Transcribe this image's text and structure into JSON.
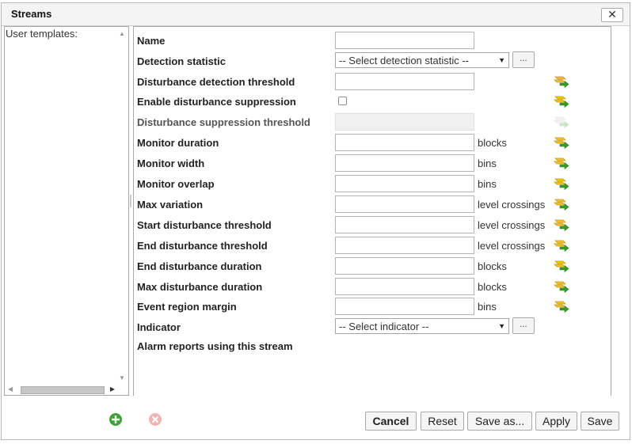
{
  "dialog": {
    "title": "Streams",
    "close_label": "✕"
  },
  "left_panel": {
    "label": "User templates:"
  },
  "form": {
    "rows": [
      {
        "label": "Name",
        "control": "input",
        "unit": "",
        "edit_icon": "none"
      },
      {
        "label": "Detection statistic",
        "control": "select",
        "value": "-- Select detection statistic --",
        "button": "...",
        "unit": "",
        "edit_icon": "none"
      },
      {
        "label": "Disturbance detection threshold",
        "control": "input",
        "unit": "",
        "edit_icon": "edit-icon"
      },
      {
        "label": "Enable disturbance suppression",
        "control": "checkbox",
        "checked": false,
        "unit": "",
        "edit_icon": "edit-icon"
      },
      {
        "label": "Disturbance suppression threshold",
        "control": "input-disabled",
        "unit": "",
        "edit_icon": "edit-icon-disabled"
      },
      {
        "label": "Monitor duration",
        "control": "input",
        "unit": "blocks",
        "edit_icon": "edit-icon"
      },
      {
        "label": "Monitor width",
        "control": "input",
        "unit": "bins",
        "edit_icon": "edit-icon"
      },
      {
        "label": "Monitor overlap",
        "control": "input",
        "unit": "bins",
        "edit_icon": "edit-icon"
      },
      {
        "label": "Max variation",
        "control": "input",
        "unit": "level crossings",
        "edit_icon": "edit-icon"
      },
      {
        "label": "Start disturbance threshold",
        "control": "input",
        "unit": "level crossings",
        "edit_icon": "edit-icon"
      },
      {
        "label": "End disturbance threshold",
        "control": "input",
        "unit": "level crossings",
        "edit_icon": "edit-icon"
      },
      {
        "label": "End disturbance duration",
        "control": "input",
        "unit": "blocks",
        "edit_icon": "edit-icon"
      },
      {
        "label": "Max disturbance duration",
        "control": "input",
        "unit": "blocks",
        "edit_icon": "edit-icon"
      },
      {
        "label": "Event region margin",
        "control": "input",
        "unit": "bins",
        "edit_icon": "edit-icon"
      },
      {
        "label": "Indicator",
        "control": "select",
        "value": "-- Select indicator --",
        "button": "...",
        "unit": "",
        "edit_icon": "none"
      },
      {
        "label": "Alarm reports using this stream",
        "control": "none",
        "unit": "",
        "edit_icon": "none"
      }
    ]
  },
  "footer": {
    "add_icon": "add-circle-icon",
    "remove_icon": "remove-circle-icon",
    "buttons": {
      "cancel": "Cancel",
      "reset": "Reset",
      "save_as": "Save as...",
      "apply": "Apply",
      "save": "Save"
    }
  },
  "colors": {
    "edit_icon_green": "#3a9a2a",
    "edit_icon_yellow": "#f2c230",
    "add_green": "#3fa33a",
    "remove_red": "#e06a6a"
  }
}
